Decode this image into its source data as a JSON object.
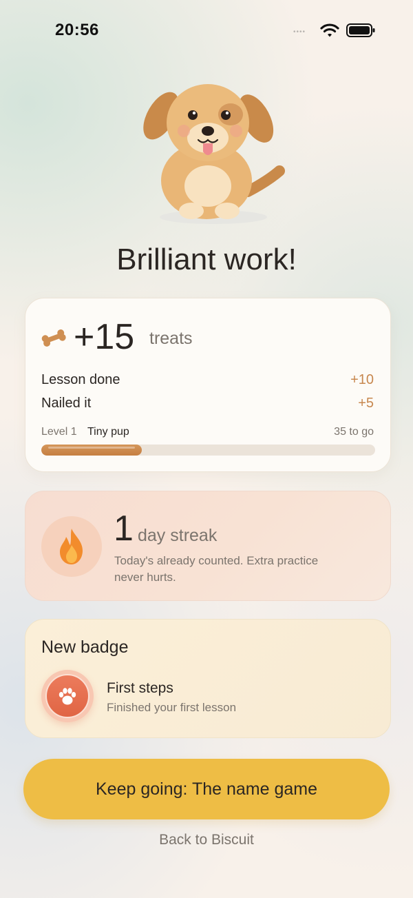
{
  "status_bar": {
    "time": "20:56",
    "signal": "••••"
  },
  "headline": "Brilliant work!",
  "treats_card": {
    "total": "+15",
    "unit": "treats",
    "lines": [
      {
        "label": "Lesson done",
        "value": "+10"
      },
      {
        "label": "Nailed it",
        "value": "+5"
      }
    ],
    "level_number": "Level 1",
    "level_name": "Tiny pup",
    "remaining": "35 to go",
    "progress_fraction": 0.3
  },
  "streak_card": {
    "count": "1",
    "label": "day streak",
    "note": "Today's already counted. Extra practice never hurts."
  },
  "badge_card": {
    "heading": "New badge",
    "title": "First steps",
    "subtitle": "Finished your first lesson"
  },
  "cta_label": "Keep going: The name game",
  "back_label": "Back to Biscuit",
  "icons": [
    "wifi-icon",
    "battery-icon",
    "bone-icon",
    "flame-icon",
    "paw-icon",
    "dog-mascot"
  ],
  "colors": {
    "accent": "#eebd45",
    "treat": "#c7874e",
    "badge": "#e06544",
    "flame": "#f28c2c"
  }
}
